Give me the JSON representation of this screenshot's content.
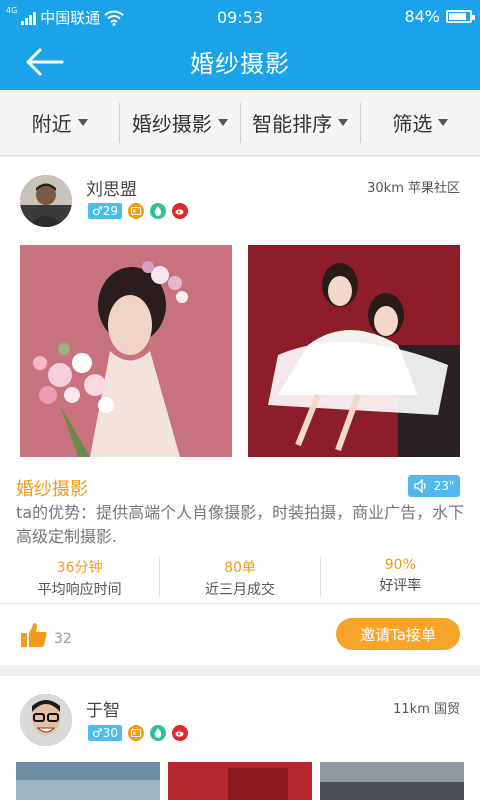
{
  "status_bar": {
    "network_tag": "4G",
    "carrier": "中国联通",
    "time": "09:53",
    "battery": "84%",
    "battery_level": 0.84
  },
  "navbar": {
    "title": "婚纱摄影"
  },
  "filters": [
    {
      "label": "附近"
    },
    {
      "label": "婚纱摄影"
    },
    {
      "label": "智能排序"
    },
    {
      "label": "筛选"
    }
  ],
  "cards": [
    {
      "name": "刘思盟",
      "distance": "30km 苹果社区",
      "gender_age": "♂29",
      "category": "婚纱摄影",
      "voice_duration": "23\"",
      "description": "ta的优势：提供高端个人肖像摄影，时装拍摄，商业广告，水下高级定制摄影.",
      "stats": [
        {
          "value": "36分钟",
          "label": "平均响应时间"
        },
        {
          "value": "80单",
          "label": "近三月成交"
        },
        {
          "value": "90%",
          "label": "好评率"
        }
      ],
      "likes": "32",
      "invite_label": "邀请Ta接单"
    },
    {
      "name": "于智",
      "distance": "11km 国贸",
      "gender_age": "♂30"
    }
  ],
  "colors": {
    "primary": "#1aa3e8",
    "accent": "#f39a18",
    "button": "#f7a42a",
    "badge_blue": "#4dbdf0"
  },
  "icons": [
    "back-arrow-icon",
    "like-icon",
    "speaker-icon",
    "id-card-icon",
    "water-drop-icon",
    "weibo-icon",
    "wifi-icon",
    "signal-icon",
    "battery-icon"
  ]
}
